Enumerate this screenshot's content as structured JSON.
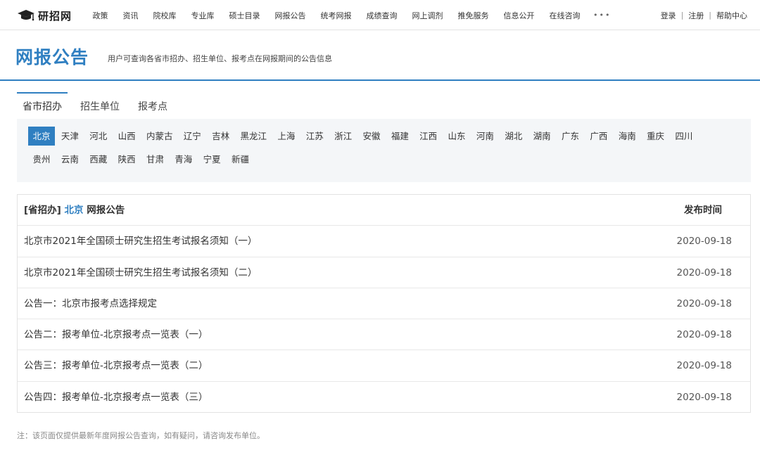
{
  "brand": {
    "name": "研招网"
  },
  "nav": {
    "items": [
      "政策",
      "资讯",
      "院校库",
      "专业库",
      "硕士目录",
      "网报公告",
      "统考网报",
      "成绩查询",
      "网上调剂",
      "推免服务",
      "信息公开",
      "在线咨询"
    ],
    "more": "•••"
  },
  "user_links": {
    "login": "登录",
    "register": "注册",
    "help": "帮助中心",
    "separator": "|"
  },
  "header": {
    "title": "网报公告",
    "description": "用户可查询各省市招办、招生单位、报考点在网报期间的公告信息"
  },
  "tabs": [
    {
      "label": "省市招办",
      "active": true
    },
    {
      "label": "招生单位",
      "active": false
    },
    {
      "label": "报考点",
      "active": false
    }
  ],
  "regions": {
    "row1": [
      "北京",
      "天津",
      "河北",
      "山西",
      "内蒙古",
      "辽宁",
      "吉林",
      "黑龙江",
      "上海",
      "江苏",
      "浙江",
      "安徽",
      "福建",
      "江西",
      "山东",
      "河南",
      "湖北",
      "湖南",
      "广东",
      "广西",
      "海南",
      "重庆",
      "四川"
    ],
    "row2": [
      "贵州",
      "云南",
      "西藏",
      "陕西",
      "甘肃",
      "青海",
      "宁夏",
      "新疆"
    ],
    "selected": "北京"
  },
  "table": {
    "header_prefix": "[省招办]",
    "header_region": "北京",
    "header_suffix": "网报公告",
    "date_header": "发布时间",
    "rows": [
      {
        "title": "北京市2021年全国硕士研究生招生考试报名须知（一）",
        "date": "2020-09-18"
      },
      {
        "title": "北京市2021年全国硕士研究生招生考试报名须知（二）",
        "date": "2020-09-18"
      },
      {
        "title": "公告一：北京市报考点选择规定",
        "date": "2020-09-18"
      },
      {
        "title": "公告二：报考单位-北京报考点一览表（一）",
        "date": "2020-09-18"
      },
      {
        "title": "公告三：报考单位-北京报考点一览表（二）",
        "date": "2020-09-18"
      },
      {
        "title": "公告四：报考单位-北京报考点一览表（三）",
        "date": "2020-09-18"
      }
    ]
  },
  "footnote": "注：该页面仅提供最新年度网报公告查询，如有疑问，请咨询发布单位。",
  "colors": {
    "accent": "#2f7fc1",
    "panel_bg": "#f4f6f8",
    "border": "#e3e3e3"
  }
}
